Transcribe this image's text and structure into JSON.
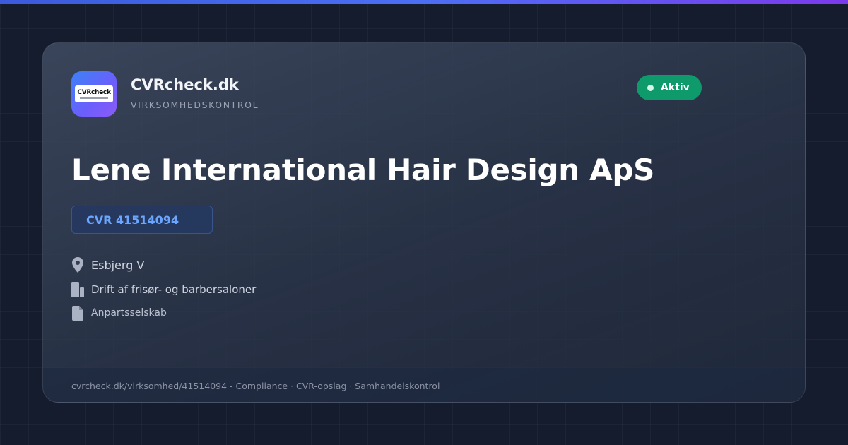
{
  "brand": {
    "name": "CVRcheck.dk",
    "subtitle": "VIRKSOMHEDSKONTROL",
    "logo_text": "CVRcheck"
  },
  "status": {
    "label": "Aktiv",
    "color": "#0f9a6c"
  },
  "company": {
    "name": "Lene International Hair Design ApS",
    "cvr": "CVR 41514094"
  },
  "details": {
    "location": {
      "icon": "location-pin-icon",
      "text": "Esbjerg V"
    },
    "industry": {
      "icon": "building-icon",
      "text": "Drift af frisør- og barbersaloner"
    },
    "company_type": {
      "icon": "document-icon",
      "text": "Anpartsselskab"
    }
  },
  "footer": {
    "text": "cvrcheck.dk/virksomhed/41514094 - Compliance · CVR-opslag · Samhandelskontrol"
  },
  "colors": {
    "accent": "#6aa6ff",
    "background": "#141c2e",
    "status_green": "#0f9a6c"
  }
}
